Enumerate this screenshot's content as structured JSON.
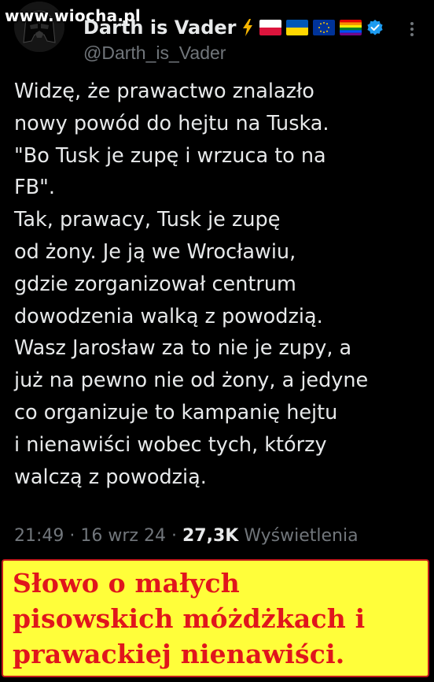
{
  "watermark": "www.wiocha.pl",
  "author": {
    "display_name": "Darth is Vader",
    "handle": "@Darth_is_Vader",
    "badges": [
      "lightning-icon",
      "poland-flag-icon",
      "ukraine-flag-icon",
      "eu-flag-icon",
      "rainbow-flag-icon",
      "verified-icon"
    ]
  },
  "tweet": {
    "lines": [
      "Widzę, że prawactwo znalazło",
      "nowy powód do hejtu na Tuska.",
      "\"Bo Tusk je zupę i wrzuca to na",
      "FB\".",
      "Tak, prawacy, Tusk je zupę",
      "od żony. Je ją we Wrocławiu,",
      "gdzie zorganizował centrum",
      "dowodzenia walką z powodzią.",
      "Wasz Jarosław za to nie je zupy, a",
      "już na pewno nie od żony, a jedyne",
      "co organizuje to kampanię hejtu",
      "i nienawiści wobec tych, którzy",
      "walczą z powodzią."
    ],
    "time": "21:49",
    "separator": "·",
    "date": "16 wrz 24",
    "views_count": "27,3K",
    "views_label": "Wyświetlenia"
  },
  "caption": {
    "lines": [
      "Słowo o małych",
      "pisowskich móżdżkach i",
      "prawackiej nienawiści."
    ]
  },
  "colors": {
    "background": "#000000",
    "text": "#e7e9ea",
    "muted": "#71767b",
    "verified": "#1d9bf0",
    "caption_bg": "#fffe3a",
    "caption_text": "#e0161c"
  }
}
